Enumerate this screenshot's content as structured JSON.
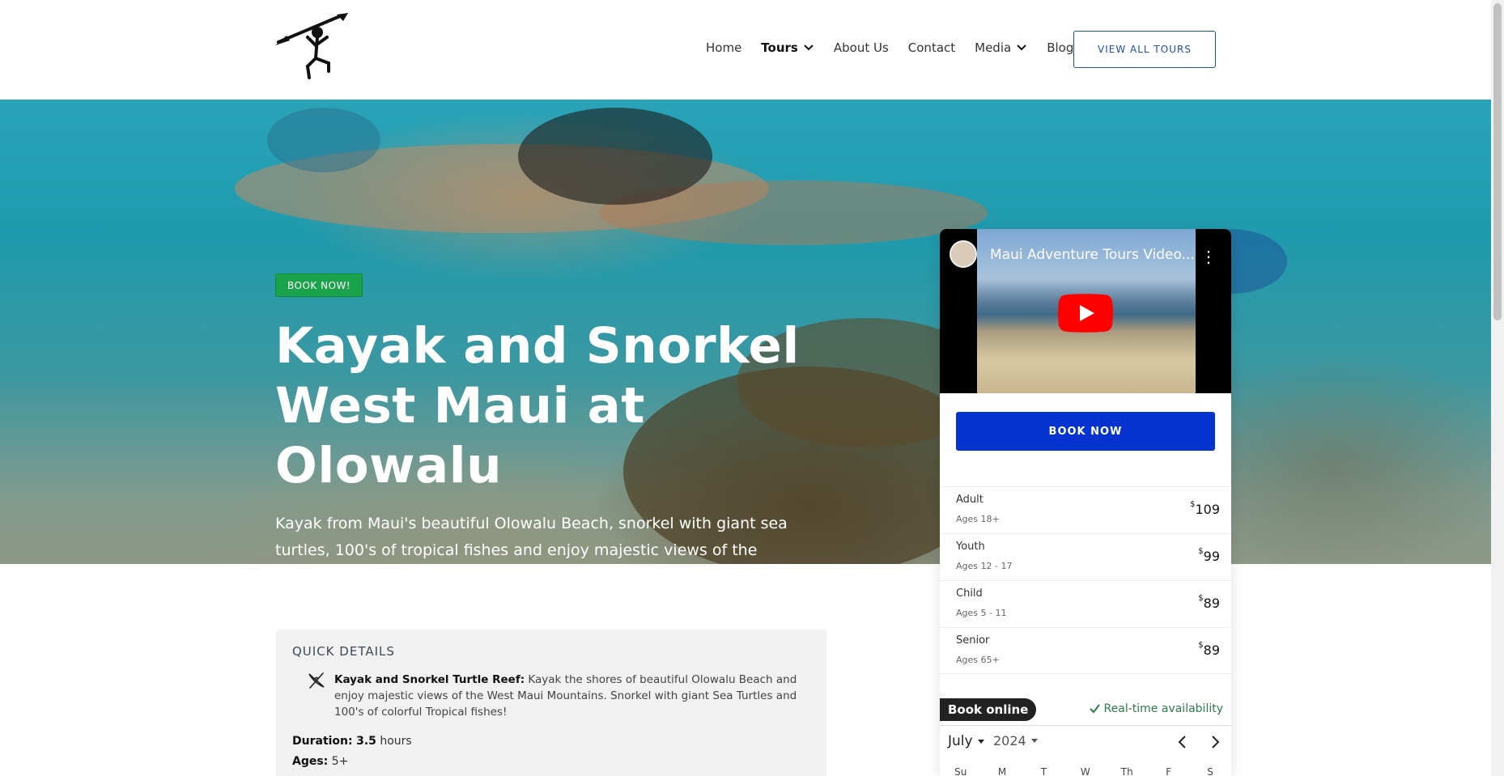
{
  "header": {
    "logo_name": "kayaker-petroglyph-logo",
    "nav": [
      {
        "label": "Home",
        "dropdown": false,
        "active": false
      },
      {
        "label": "Tours",
        "dropdown": true,
        "active": true
      },
      {
        "label": "About Us",
        "dropdown": false,
        "active": false
      },
      {
        "label": "Contact",
        "dropdown": false,
        "active": false
      },
      {
        "label": "Media",
        "dropdown": true,
        "active": false
      },
      {
        "label": "Blog",
        "dropdown": false,
        "active": false
      }
    ],
    "cta_label": "VIEW ALL TOURS"
  },
  "hero": {
    "badge": "BOOK NOW!",
    "title": "Kayak and Snorkel West Maui at Olowalu",
    "subtitle": "Kayak from Maui's beautiful Olowalu Beach, snorkel with giant sea turtles, 100's of tropical fishes and enjoy majestic views of the West Maui Mountains"
  },
  "booking": {
    "video_title": "Maui Adventure Tours Video...",
    "book_button": "BOOK NOW",
    "prices": [
      {
        "name": "Adult",
        "ages": "Ages 18+",
        "currency": "$",
        "amount": "109"
      },
      {
        "name": "Youth",
        "ages": "Ages 12 - 17",
        "currency": "$",
        "amount": "99"
      },
      {
        "name": "Child",
        "ages": "Ages 5 - 11",
        "currency": "$",
        "amount": "89"
      },
      {
        "name": "Senior",
        "ages": "Ages 65+",
        "currency": "$",
        "amount": "89"
      }
    ],
    "book_online": "Book online",
    "realtime": "Real-time availability",
    "calendar": {
      "month": "July",
      "year": "2024",
      "weekdays": [
        "Su",
        "M",
        "T",
        "W",
        "Th",
        "F",
        "S"
      ]
    }
  },
  "quick_details": {
    "title": "QUICK DETAILS",
    "tour_name": "Kayak and Snorkel Turtle Reef:",
    "tour_desc": "Kayak the shores of beautiful Olowalu Beach and enjoy majestic views of the West Maui Mountains. Snorkel with giant Sea Turtles and 100's of colorful Tropical fishes!",
    "duration_label": "Duration:",
    "duration_value": "3.5",
    "duration_unit": "hours",
    "ages_label": "Ages:",
    "ages_value": "5+"
  },
  "colors": {
    "accent_blue": "#0433d0",
    "outline_blue": "#1e4fa0",
    "badge_green": "#1aa34a",
    "availability_green": "#2d7a4a"
  }
}
